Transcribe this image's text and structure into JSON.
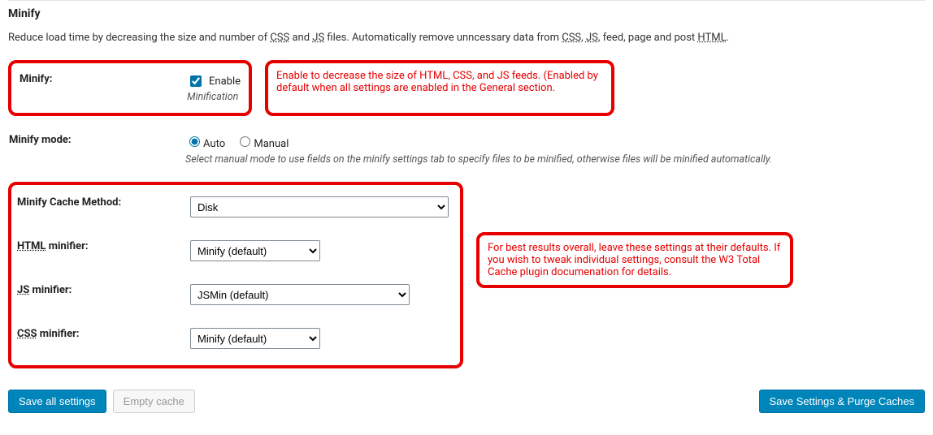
{
  "section": {
    "title": "Minify",
    "desc_pre": "Reduce load time by decreasing the size and number of ",
    "abbr_css": "CSS",
    "desc_mid1": " and ",
    "abbr_js": "JS",
    "desc_mid2": " files. Automatically remove unncessary data from ",
    "desc_mid3": ", ",
    "desc_mid4": ", feed, page and post ",
    "abbr_html": "HTML",
    "desc_end": "."
  },
  "rows": {
    "minify": {
      "label": "Minify:",
      "enable_label": "Enable",
      "subtext": "Minification",
      "callout": "Enable to decrease the size of HTML, CSS, and JS feeds. (Enabled by default when all settings are enabled in the General section."
    },
    "mode": {
      "label": "Minify mode:",
      "auto": "Auto",
      "manual": "Manual",
      "note": "Select manual mode to use fields on the minify settings tab to specify files to be minified, otherwise files will be minified automatically."
    },
    "cache_method": {
      "label": "Minify Cache Method:",
      "options": [
        "Disk"
      ]
    },
    "html_min": {
      "abbr": "HTML",
      "label_suffix": " minifier:",
      "options": [
        "Minify (default)"
      ]
    },
    "js_min": {
      "abbr": "JS",
      "label_suffix": " minifier:",
      "options": [
        "JSMin (default)"
      ]
    },
    "css_min": {
      "abbr": "CSS",
      "label_suffix": " minifier:",
      "options": [
        "Minify (default)"
      ]
    },
    "method_callout": "For best results overall, leave these settings at their defaults. If you wish to tweak individual settings, consult the W3 Total Cache plugin documenation for details."
  },
  "buttons": {
    "save_all": "Save all settings",
    "empty_cache": "Empty cache",
    "save_purge": "Save Settings & Purge Caches"
  }
}
